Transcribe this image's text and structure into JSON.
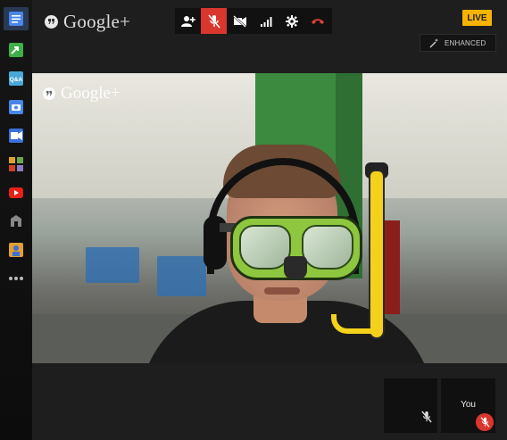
{
  "app": {
    "brand": "Google+",
    "watermark": "Google+"
  },
  "sidebar": {
    "items": [
      {
        "name": "chat-icon",
        "color": "#4a86e8",
        "active": true
      },
      {
        "name": "share-icon",
        "color": "#3fae49"
      },
      {
        "name": "qa-icon",
        "label": "Q&A",
        "color": "#4aa8d8"
      },
      {
        "name": "camera-icon",
        "color": "#4a86e8"
      },
      {
        "name": "video-effects-icon",
        "color": "#3c6fd9"
      },
      {
        "name": "apps-icon",
        "color": "#e0a030"
      },
      {
        "name": "youtube-icon",
        "color": "#e62117"
      },
      {
        "name": "app-icon",
        "color": "#888888"
      },
      {
        "name": "app-icon-2",
        "color": "#e0a030"
      },
      {
        "name": "more-icon",
        "color": "#bbbbbb"
      }
    ]
  },
  "toolbar": {
    "buttons": [
      {
        "name": "invite-people-icon"
      },
      {
        "name": "mute-mic-icon",
        "active": true
      },
      {
        "name": "video-off-icon"
      },
      {
        "name": "bandwidth-icon"
      },
      {
        "name": "settings-icon"
      },
      {
        "name": "hang-up-icon"
      }
    ],
    "active_color": "#d9372e"
  },
  "status": {
    "live_badge": "LIVE",
    "live_color": "#f6b300",
    "enhanced_label": "ENHANCED"
  },
  "filmstrip": {
    "tiles": [
      {
        "label": "",
        "muted": true
      },
      {
        "label": "You",
        "muted": true
      }
    ]
  }
}
